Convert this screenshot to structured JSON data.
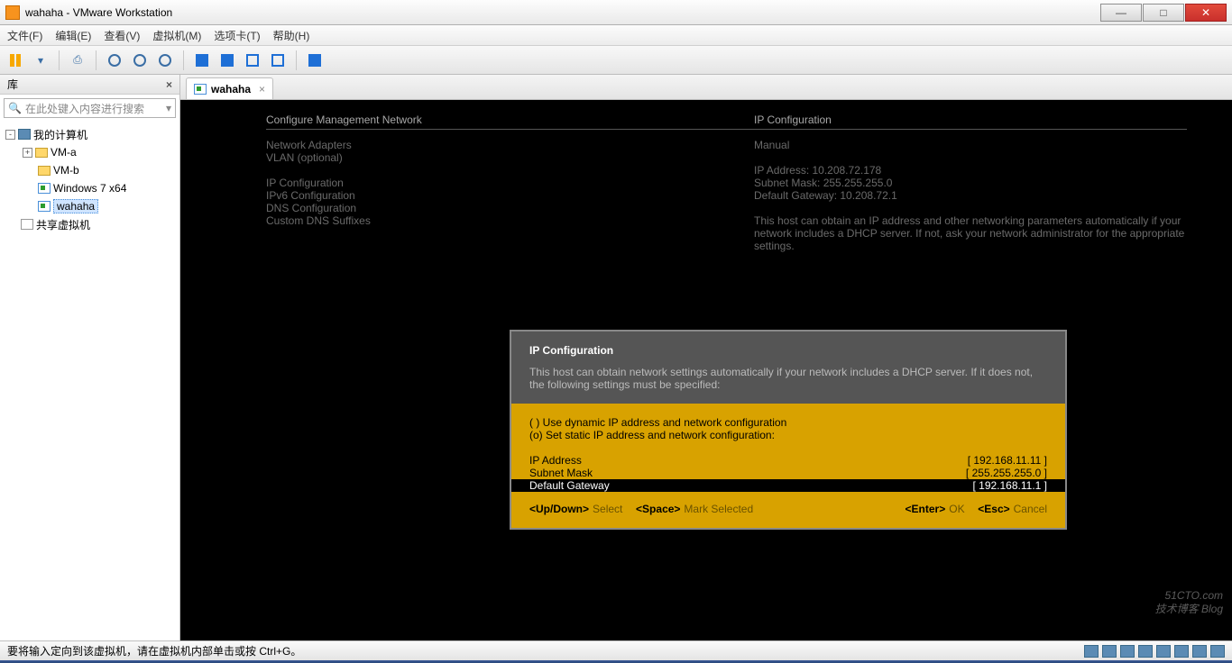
{
  "window": {
    "title": "wahaha - VMware Workstation"
  },
  "menu": {
    "file": "文件(F)",
    "edit": "编辑(E)",
    "view": "查看(V)",
    "vm": "虚拟机(M)",
    "tabs": "选项卡(T)",
    "help": "帮助(H)"
  },
  "sidebar": {
    "header": "库",
    "search_placeholder": "在此处键入内容进行搜索",
    "root": "我的计算机",
    "items": [
      "VM-a",
      "VM-b",
      "Windows 7 x64",
      "wahaha"
    ],
    "shared": "共享虚拟机"
  },
  "tab": {
    "label": "wahaha"
  },
  "console": {
    "hdr_left": "Configure Management Network",
    "hdr_right": "IP Configuration",
    "left_lines": [
      "Network Adapters",
      "VLAN (optional)",
      "",
      "IP Configuration",
      "IPv6 Configuration",
      "DNS Configuration",
      "Custom DNS Suffixes"
    ],
    "right_mode": "Manual",
    "right_ip": "IP Address: 10.208.72.178",
    "right_mask": "Subnet Mask: 255.255.255.0",
    "right_gw": "Default Gateway: 10.208.72.1",
    "right_help": "This host can obtain an IP address and other networking parameters automatically if your network includes a DHCP server. If not, ask your network administrator for the appropriate settings."
  },
  "dialog": {
    "title": "IP Configuration",
    "desc": "This host can obtain network settings automatically if your network includes a DHCP server. If it does not, the following settings must be specified:",
    "opt_dyn": "( ) Use dynamic IP address and network configuration",
    "opt_stat": "(o) Set static IP address and network configuration:",
    "rows": [
      {
        "label": "IP Address",
        "value": "[ 192.168.11.11   ]"
      },
      {
        "label": "Subnet Mask",
        "value": "[ 255.255.255.0   ]"
      },
      {
        "label": "Default Gateway",
        "value": "[ 192.168.11.1    ]"
      }
    ],
    "foot": {
      "updown": "<Up/Down>",
      "select": "Select",
      "space": "<Space>",
      "mark": "Mark Selected",
      "enter": "<Enter>",
      "ok": "OK",
      "esc": "<Esc>",
      "cancel": "Cancel"
    }
  },
  "status": {
    "text": "要将输入定向到该虚拟机，请在虚拟机内部单击或按 Ctrl+G。"
  },
  "watermark": {
    "site": "51CTO.com",
    "sub": "技术博客  Blog"
  }
}
